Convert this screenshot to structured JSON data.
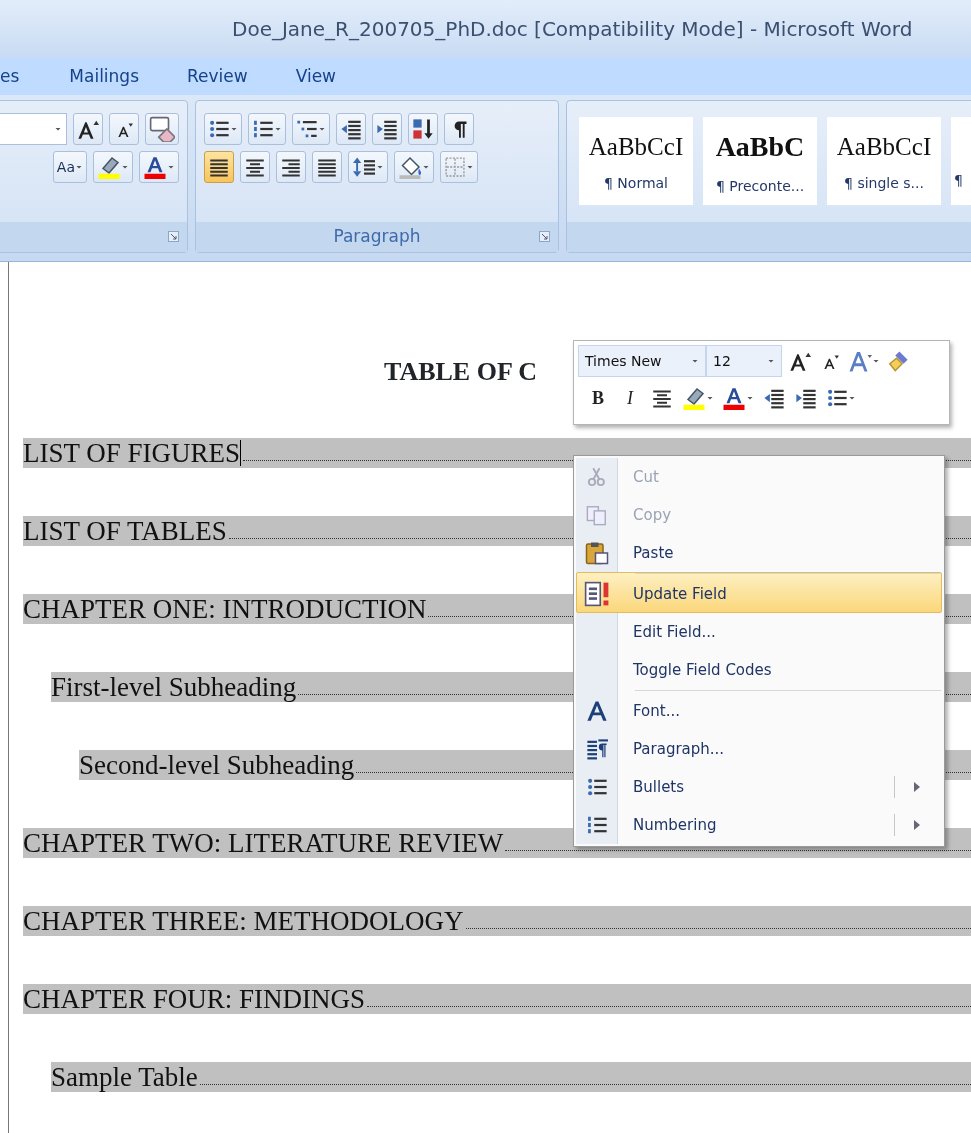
{
  "window": {
    "title": "Doe_Jane_R_200705_PhD.doc [Compatibility Mode] - Microsoft Word"
  },
  "ribbon_tabs": [
    {
      "label": "es",
      "selected": false
    },
    {
      "label": "Mailings",
      "selected": false
    },
    {
      "label": "Review",
      "selected": false
    },
    {
      "label": "View",
      "selected": false
    }
  ],
  "ribbon": {
    "font_group": {
      "rows": [
        [
          {
            "kind": "dropdown",
            "selected": false
          },
          {
            "kind": "grow-font",
            "selected": false
          },
          {
            "kind": "shrink-font",
            "selected": false
          },
          {
            "kind": "clear-format",
            "selected": false
          }
        ],
        [
          {
            "kind": "change-case",
            "label": "Aa",
            "selected": false
          },
          {
            "kind": "highlight",
            "selected": false
          },
          {
            "kind": "font-color",
            "selected": false
          }
        ]
      ]
    },
    "paragraph_group": {
      "label": "Paragraph",
      "rows": [
        [
          {
            "kind": "bullets",
            "selected": false
          },
          {
            "kind": "numbering",
            "selected": false
          },
          {
            "kind": "multilevel",
            "selected": false
          },
          {
            "kind": "decrease-indent",
            "selected": false
          },
          {
            "kind": "increase-indent",
            "selected": false
          },
          {
            "kind": "sort",
            "selected": false
          },
          {
            "kind": "pilcrow",
            "selected": false
          }
        ],
        [
          {
            "kind": "align-left",
            "selected": true
          },
          {
            "kind": "align-center",
            "selected": false
          },
          {
            "kind": "align-right",
            "selected": false
          },
          {
            "kind": "justify",
            "selected": false
          },
          {
            "kind": "line-spacing",
            "selected": false
          },
          {
            "kind": "shading",
            "selected": false
          },
          {
            "kind": "borders",
            "selected": false
          }
        ]
      ]
    },
    "styles": [
      {
        "sample": "AaBbCcI",
        "name": "¶ Normal",
        "bold": false
      },
      {
        "sample": "AaBbC",
        "name": "¶ Preconte...",
        "bold": true
      },
      {
        "sample": "AaBbCcI",
        "name": "¶ single s...",
        "bold": false
      },
      {
        "name": "¶",
        "bold": false
      }
    ]
  },
  "document": {
    "title": "TABLE OF C",
    "toc": [
      {
        "text": "LIST OF FIGURES",
        "cursor": true
      },
      {
        "text": "LIST OF TABLES",
        "cursor": false
      },
      {
        "text": "CHAPTER ONE: INTRODUCTION",
        "cursor": false,
        "children": [
          {
            "text": "First-level Subheading",
            "cursor": false,
            "children": [
              {
                "text": "Second-level Subheading",
                "cursor": false
              }
            ]
          }
        ]
      },
      {
        "text": "CHAPTER TWO: LITERATURE REVIEW",
        "cursor": false
      },
      {
        "text": "CHAPTER THREE: METHODOLOGY",
        "cursor": false
      },
      {
        "text": "CHAPTER FOUR: FINDINGS",
        "cursor": false,
        "children": [
          {
            "text": "Sample Table",
            "cursor": false
          }
        ]
      }
    ]
  },
  "mini_toolbar": {
    "font": "Times New",
    "size": "12",
    "rows": [
      [
        {
          "kind": "grow-font"
        },
        {
          "kind": "shrink-font"
        },
        {
          "kind": "styles"
        },
        {
          "kind": "format-painter"
        }
      ],
      [
        {
          "kind": "bold",
          "label": "B"
        },
        {
          "kind": "italic",
          "label": "I"
        },
        {
          "kind": "align-center"
        },
        {
          "kind": "highlight"
        },
        {
          "kind": "font-color"
        },
        {
          "kind": "decrease-indent"
        },
        {
          "kind": "increase-indent"
        },
        {
          "kind": "bullets"
        }
      ]
    ]
  },
  "context_menu": [
    {
      "label": "Cut",
      "kind": "cut",
      "disabled": true,
      "selected": false,
      "separator_before": false,
      "submenu": false
    },
    {
      "label": "Copy",
      "kind": "copy",
      "disabled": true,
      "selected": false,
      "separator_before": false,
      "submenu": false
    },
    {
      "label": "Paste",
      "kind": "paste",
      "disabled": false,
      "selected": false,
      "separator_before": false,
      "submenu": false
    },
    {
      "label": "Update Field",
      "kind": "update",
      "disabled": false,
      "selected": true,
      "separator_before": true,
      "submenu": false
    },
    {
      "label": "Edit Field...",
      "disabled": false,
      "selected": false,
      "separator_before": false,
      "submenu": false
    },
    {
      "label": "Toggle Field Codes",
      "disabled": false,
      "selected": false,
      "separator_before": false,
      "submenu": false
    },
    {
      "label": "Font...",
      "kind": "font",
      "disabled": false,
      "selected": false,
      "separator_before": true,
      "submenu": false
    },
    {
      "label": "Paragraph...",
      "kind": "paragraph",
      "disabled": false,
      "selected": false,
      "separator_before": false,
      "submenu": false
    },
    {
      "label": "Bullets",
      "kind": "bullets",
      "disabled": false,
      "selected": false,
      "separator_before": false,
      "submenu": true
    },
    {
      "label": "Numbering",
      "kind": "numbering",
      "disabled": false,
      "selected": false,
      "separator_before": false,
      "submenu": true
    }
  ]
}
